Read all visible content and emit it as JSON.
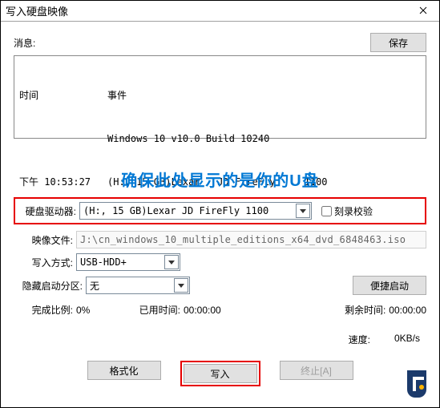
{
  "window": {
    "title": "写入硬盘映像"
  },
  "msg": {
    "label": "消息:",
    "save": "保存"
  },
  "log": {
    "time_header": "时间",
    "event_header": "事件",
    "line1": "Windows 10 v10.0 Build 10240",
    "time2": "下午 10:53:27",
    "line2": "(H:, 15 GB)Lexar   JD FireFly     1100"
  },
  "callout": "确保此处显示的是你的U盘",
  "fields": {
    "drive_label": "硬盘驱动器:",
    "drive_value": "(H:, 15 GB)Lexar   JD FireFly     1100",
    "verify_label": "刻录校验",
    "image_label": "映像文件:",
    "image_value": "J:\\cn_windows_10_multiple_editions_x64_dvd_6848463.iso",
    "mode_label": "写入方式:",
    "mode_value": "USB-HDD+",
    "hidden_label": "隐藏启动分区:",
    "hidden_value": "无",
    "boot_btn": "便捷启动"
  },
  "progress": {
    "done_label": "完成比例:",
    "done_value": "0%",
    "elapsed_label": "已用时间:",
    "elapsed_value": "00:00:00",
    "remain_label": "剩余时间:",
    "remain_value": "00:00:00",
    "speed_label": "速度:",
    "speed_value": "0KB/s"
  },
  "buttons": {
    "format": "格式化",
    "write": "写入",
    "abort": "终止[A]"
  }
}
